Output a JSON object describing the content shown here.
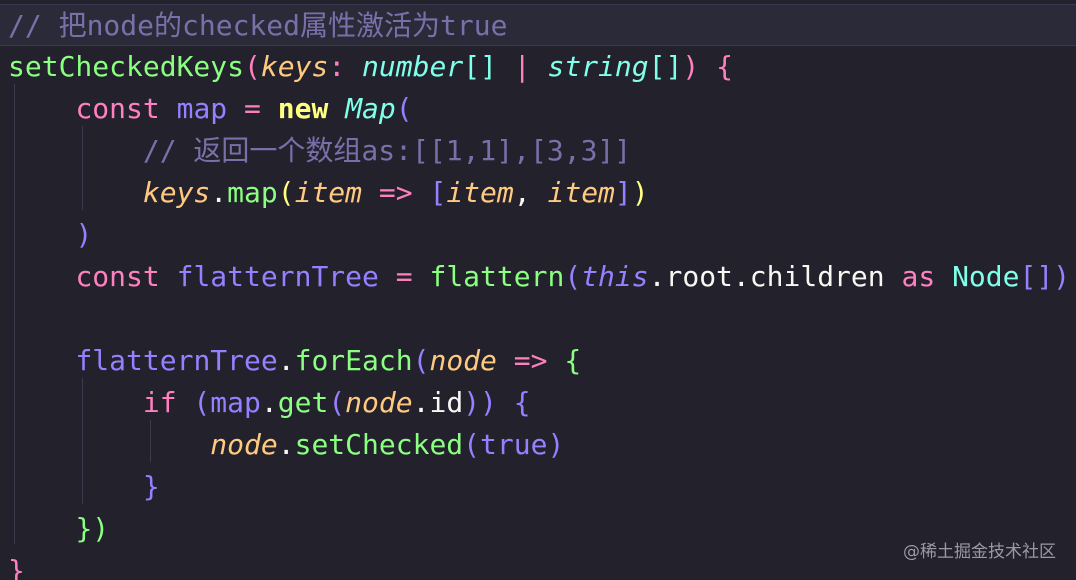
{
  "editor": {
    "theme_colors": {
      "background": "#22212c",
      "comment": "#7970a9",
      "function": "#8aff80",
      "parameter": "#ffca80",
      "keyword": "#ff80bf",
      "type": "#80ffea",
      "punctuation": "#9580ff"
    },
    "lines": [
      [
        {
          "t": "// 把node的checked属性激活为true",
          "c": "comment"
        }
      ],
      [
        {
          "t": "setCheckedKeys",
          "c": "fn"
        },
        {
          "t": "(",
          "c": "pink"
        },
        {
          "t": "keys",
          "c": "param"
        },
        {
          "t": ": ",
          "c": "pink"
        },
        {
          "t": "number",
          "c": "type"
        },
        {
          "t": "[]",
          "c": "class"
        },
        {
          "t": " | ",
          "c": "pink"
        },
        {
          "t": "string",
          "c": "type"
        },
        {
          "t": "[]",
          "c": "class"
        },
        {
          "t": ") {",
          "c": "pink"
        }
      ],
      [
        {
          "t": "    ",
          "c": "plain"
        },
        {
          "t": "const",
          "c": "pink"
        },
        {
          "t": " map ",
          "c": "purple"
        },
        {
          "t": "=",
          "c": "pink"
        },
        {
          "t": " ",
          "c": "plain"
        },
        {
          "t": "new",
          "c": "yellowbold"
        },
        {
          "t": " ",
          "c": "plain"
        },
        {
          "t": "Map",
          "c": "type"
        },
        {
          "t": "(",
          "c": "purple"
        }
      ],
      [
        {
          "t": "        ",
          "c": "plain"
        },
        {
          "t": "// 返回一个数组as:[[1,1],[3,3]]",
          "c": "comment"
        }
      ],
      [
        {
          "t": "        ",
          "c": "plain"
        },
        {
          "t": "keys",
          "c": "param"
        },
        {
          "t": ".",
          "c": "plain"
        },
        {
          "t": "map",
          "c": "fn"
        },
        {
          "t": "(",
          "c": "yellow"
        },
        {
          "t": "item",
          "c": "param"
        },
        {
          "t": " => ",
          "c": "pink"
        },
        {
          "t": "[",
          "c": "purple"
        },
        {
          "t": "item",
          "c": "param"
        },
        {
          "t": ", ",
          "c": "plain"
        },
        {
          "t": "item",
          "c": "param"
        },
        {
          "t": "]",
          "c": "purple"
        },
        {
          "t": ")",
          "c": "yellow"
        }
      ],
      [
        {
          "t": "    ",
          "c": "plain"
        },
        {
          "t": ")",
          "c": "purple"
        }
      ],
      [
        {
          "t": "    ",
          "c": "plain"
        },
        {
          "t": "const",
          "c": "pink"
        },
        {
          "t": " flatternTree ",
          "c": "purple"
        },
        {
          "t": "=",
          "c": "pink"
        },
        {
          "t": " ",
          "c": "plain"
        },
        {
          "t": "flattern",
          "c": "fn"
        },
        {
          "t": "(",
          "c": "purple"
        },
        {
          "t": "this",
          "c": "italpurple"
        },
        {
          "t": ".root.children ",
          "c": "plain"
        },
        {
          "t": "as",
          "c": "pink"
        },
        {
          "t": " ",
          "c": "plain"
        },
        {
          "t": "Node",
          "c": "class"
        },
        {
          "t": "[])",
          "c": "purple"
        }
      ],
      [],
      [
        {
          "t": "    ",
          "c": "plain"
        },
        {
          "t": "flatternTree",
          "c": "purple"
        },
        {
          "t": ".",
          "c": "plain"
        },
        {
          "t": "forEach",
          "c": "fn"
        },
        {
          "t": "(",
          "c": "purple"
        },
        {
          "t": "node",
          "c": "param"
        },
        {
          "t": " => ",
          "c": "pink"
        },
        {
          "t": "{",
          "c": "fnbrace"
        }
      ],
      [
        {
          "t": "        ",
          "c": "plain"
        },
        {
          "t": "if",
          "c": "pink"
        },
        {
          "t": " (",
          "c": "purple"
        },
        {
          "t": "map",
          "c": "purple"
        },
        {
          "t": ".",
          "c": "plain"
        },
        {
          "t": "get",
          "c": "fn"
        },
        {
          "t": "(",
          "c": "purple"
        },
        {
          "t": "node",
          "c": "param"
        },
        {
          "t": ".id",
          "c": "plain"
        },
        {
          "t": ")) {",
          "c": "purple"
        }
      ],
      [
        {
          "t": "            ",
          "c": "plain"
        },
        {
          "t": "node",
          "c": "param"
        },
        {
          "t": ".",
          "c": "plain"
        },
        {
          "t": "setChecked",
          "c": "fn"
        },
        {
          "t": "(",
          "c": "purple"
        },
        {
          "t": "true",
          "c": "bool"
        },
        {
          "t": ")",
          "c": "purple"
        }
      ],
      [
        {
          "t": "        ",
          "c": "plain"
        },
        {
          "t": "}",
          "c": "purple"
        }
      ],
      [
        {
          "t": "    ",
          "c": "plain"
        },
        {
          "t": "})",
          "c": "fnbrace"
        }
      ],
      [
        {
          "t": "}",
          "c": "pink"
        }
      ]
    ]
  },
  "watermark": "@稀土掘金技术社区"
}
